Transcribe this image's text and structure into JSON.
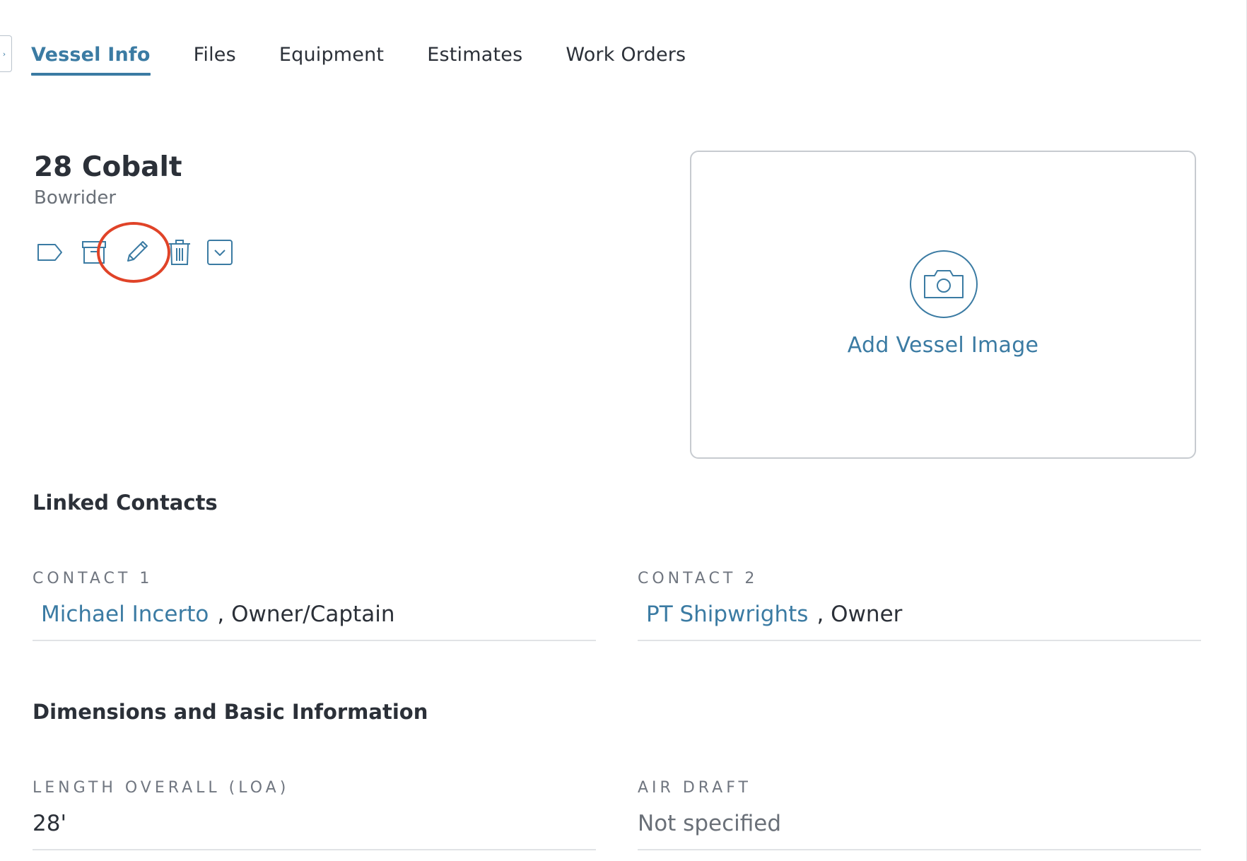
{
  "sidebar_toggle": {
    "icon": "chevron-right-icon",
    "glyph": "›"
  },
  "tabs": [
    {
      "label": "Vessel Info",
      "active": true
    },
    {
      "label": "Files",
      "active": false
    },
    {
      "label": "Equipment",
      "active": false
    },
    {
      "label": "Estimates",
      "active": false
    },
    {
      "label": "Work Orders",
      "active": false
    }
  ],
  "vessel": {
    "name": "28 Cobalt",
    "type": "Bowrider"
  },
  "actions": [
    {
      "name": "tag",
      "icon": "tag-icon"
    },
    {
      "name": "archive",
      "icon": "archive-icon"
    },
    {
      "name": "edit",
      "icon": "pencil-icon",
      "highlighted": true
    },
    {
      "name": "delete",
      "icon": "trash-icon"
    },
    {
      "name": "more",
      "icon": "chevron-down-icon"
    }
  ],
  "image_card": {
    "icon": "camera-icon",
    "label": "Add Vessel Image"
  },
  "linked_contacts": {
    "title": "Linked Contacts",
    "contacts": [
      {
        "label": "CONTACT 1",
        "name": "Michael Incerto",
        "separator": ",",
        "role": "Owner/Captain"
      },
      {
        "label": "CONTACT 2",
        "name": "PT Shipwrights",
        "separator": ",",
        "role": "Owner"
      }
    ]
  },
  "dimensions": {
    "title": "Dimensions and Basic Information",
    "fields": [
      {
        "label": "LENGTH OVERALL (LOA)",
        "value": "28'"
      },
      {
        "label": "AIR DRAFT",
        "value": "Not specified"
      }
    ]
  },
  "colors": {
    "accent": "#3b7ba3",
    "text": "#2b3038",
    "muted": "#6a7078",
    "highlight_ring": "#e04328"
  }
}
